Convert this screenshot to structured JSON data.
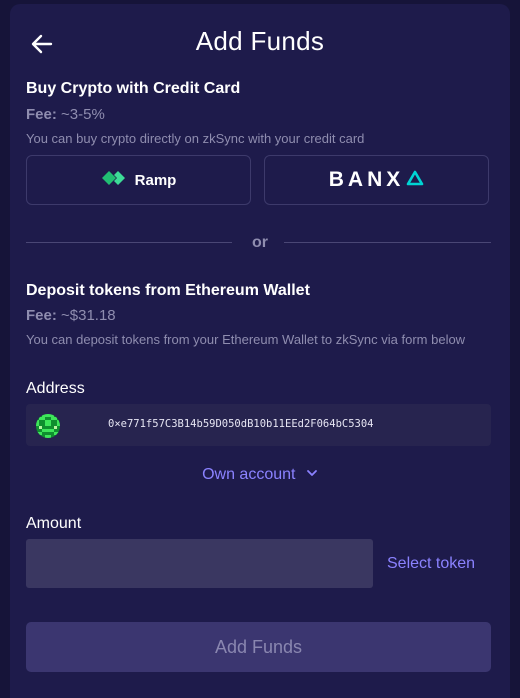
{
  "header": {
    "title": "Add Funds",
    "back_icon": "arrow-left-icon"
  },
  "card_section": {
    "title": "Buy Crypto with Credit Card",
    "fee_label": "Fee:",
    "fee_value": "~3-5%",
    "description": "You can buy crypto directly on zkSync with your credit card",
    "providers": [
      {
        "label": "Ramp",
        "icon": "ramp-logo-icon",
        "color": "#21bf73"
      },
      {
        "label": "BANX",
        "icon": "banxa-triangle-icon",
        "color": "#00d4d4"
      }
    ]
  },
  "divider_text": "or",
  "deposit_section": {
    "title": "Deposit tokens from Ethereum Wallet",
    "fee_label": "Fee:",
    "fee_value": "~$31.18",
    "description": "You can deposit tokens from your Ethereum Wallet to zkSync via form below"
  },
  "address": {
    "label": "Address",
    "value": "0×e771f57C3B14b59D050dB10b11EEd2F064bC5304",
    "avatar_icon": "wallet-avatar-icon"
  },
  "account_selector": {
    "label": "Own account",
    "icon": "chevron-down-icon"
  },
  "amount": {
    "label": "Amount",
    "value": "",
    "placeholder": "",
    "select_token_label": "Select token"
  },
  "submit_label": "Add Funds",
  "colors": {
    "background": "#1e1b4b",
    "accent": "#8b82ff",
    "ramp": "#21bf73",
    "banxa": "#00d4d4"
  }
}
